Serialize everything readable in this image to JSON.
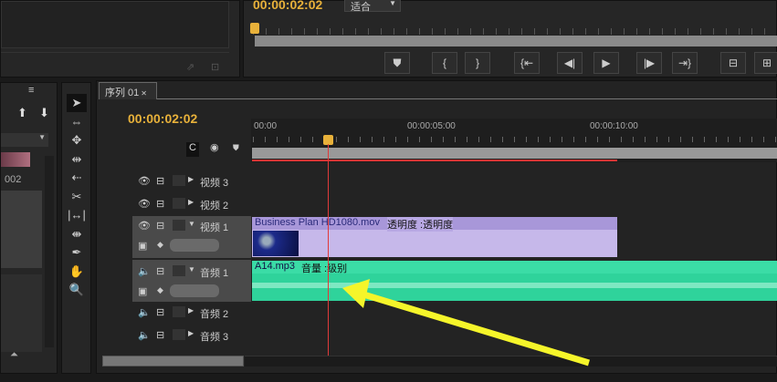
{
  "monitor": {
    "timecode": "00:00:02:02",
    "fit_select": "适合",
    "buttons": [
      {
        "name": "marker",
        "glyph": "⛊"
      },
      {
        "name": "mark-in",
        "glyph": "{"
      },
      {
        "name": "mark-out",
        "glyph": "}"
      },
      {
        "name": "go-to-in",
        "glyph": "{⇤"
      },
      {
        "name": "step-back",
        "glyph": "◀|"
      },
      {
        "name": "play",
        "glyph": "▶"
      },
      {
        "name": "step-forward",
        "glyph": "|▶"
      },
      {
        "name": "go-to-out",
        "glyph": "⇥}"
      },
      {
        "name": "lift",
        "glyph": "⊟"
      },
      {
        "name": "extract",
        "glyph": "⊞"
      }
    ]
  },
  "project": {
    "item_label": "002"
  },
  "tools": [
    "selection",
    "track-select",
    "ripple-edit",
    "rolling-edit",
    "rate-stretch",
    "razor",
    "slip",
    "slide",
    "pen",
    "hand",
    "zoom"
  ],
  "timeline": {
    "tab": "序列 01",
    "timecode": "00:00:02:02",
    "ruler": [
      "00:00",
      "00:00:05:00",
      "00:00:10:00"
    ],
    "tracks": {
      "v3": "视频 3",
      "v2": "视频 2",
      "v1": "视频 1",
      "a1": "音频 1",
      "a2": "音频 2",
      "a3": "音频 3"
    },
    "video_clip": {
      "name": "Business Plan HD1080.mov",
      "effect": "透明度 :透明度"
    },
    "audio_clip": {
      "name": "A14.mp3",
      "effect": "音量 :级别"
    }
  },
  "colors": {
    "timecode": "#e8b13a",
    "video_clip": "#c6b8ea",
    "audio_clip": "#2fd39b",
    "playhead": "#e03a3a",
    "arrow": "#f5f52a"
  }
}
